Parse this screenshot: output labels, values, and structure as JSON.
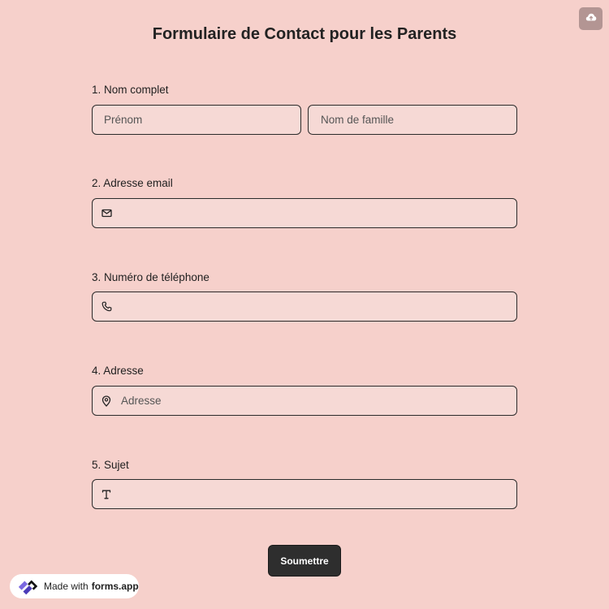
{
  "header": {
    "title": "Formulaire de Contact pour les Parents",
    "upload_icon": "cloud-upload-icon"
  },
  "questions": [
    {
      "label": "1.  Nom complet",
      "fields": [
        {
          "placeholder": "Prénom",
          "value": ""
        },
        {
          "placeholder": "Nom de famille",
          "value": ""
        }
      ]
    },
    {
      "label": "2. Adresse email",
      "icon": "mail-icon",
      "placeholder": "",
      "value": ""
    },
    {
      "label": "3. Numéro de téléphone",
      "icon": "phone-icon",
      "placeholder": "",
      "value": ""
    },
    {
      "label": "4. Adresse",
      "icon": "map-pin-icon",
      "placeholder": "Adresse",
      "value": ""
    },
    {
      "label": "5. Sujet",
      "icon": "text-icon",
      "placeholder": "",
      "value": ""
    }
  ],
  "submit": {
    "label": "Soumettre"
  },
  "badge": {
    "made_with": "Made with",
    "brand": "forms.app",
    "logo_icon": "forms-app-logo-icon"
  },
  "colors": {
    "background": "#f6d0cb",
    "field_background": "#f6d9d5",
    "field_border": "#2b2b2b",
    "button": "#2e2e2e",
    "upload_button": "#b39593",
    "logo_accent": "#6b5bd6"
  }
}
